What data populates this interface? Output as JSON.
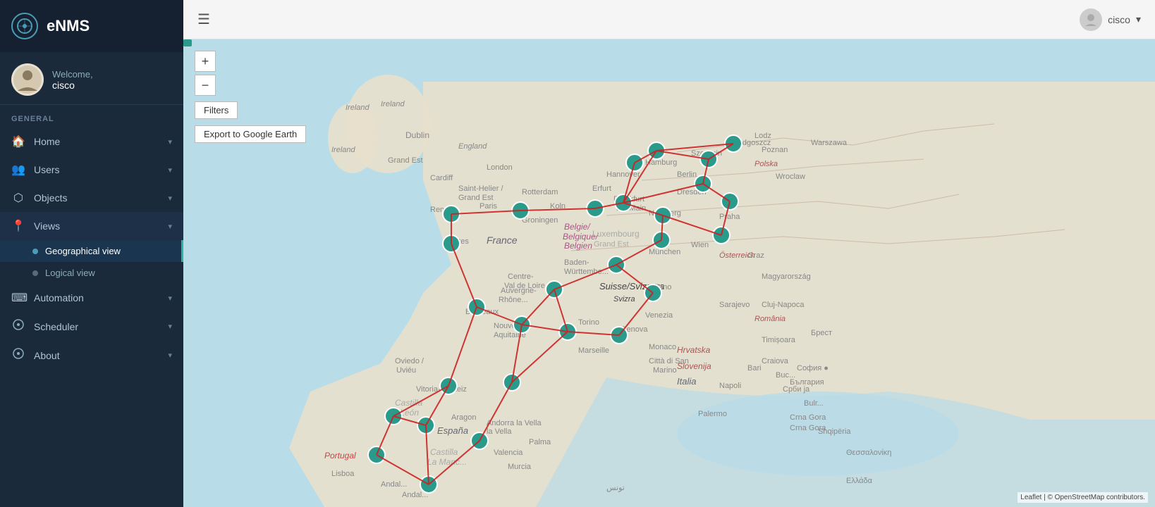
{
  "app": {
    "name": "eNMS",
    "logo_symbol": "⊙"
  },
  "user": {
    "welcome_text": "Welcome,",
    "name": "cisco",
    "avatar_emoji": "👤"
  },
  "topbar": {
    "user_label": "cisco",
    "chevron": "▾"
  },
  "sidebar": {
    "general_label": "GENERAL",
    "items": [
      {
        "id": "home",
        "label": "Home",
        "icon": "🏠",
        "has_children": true,
        "expanded": false
      },
      {
        "id": "users",
        "label": "Users",
        "icon": "👥",
        "has_children": true,
        "expanded": false
      },
      {
        "id": "objects",
        "label": "Objects",
        "icon": "⬡",
        "has_children": true,
        "expanded": false
      },
      {
        "id": "views",
        "label": "Views",
        "icon": "📍",
        "has_children": true,
        "expanded": true
      },
      {
        "id": "automation",
        "label": "Automation",
        "icon": "⌨",
        "has_children": true,
        "expanded": false
      },
      {
        "id": "scheduler",
        "label": "Scheduler",
        "icon": "⊙",
        "has_children": true,
        "expanded": false
      },
      {
        "id": "about",
        "label": "About",
        "icon": "⊙",
        "has_children": true,
        "expanded": false
      }
    ],
    "views_children": [
      {
        "id": "geographical-view",
        "label": "Geographical view",
        "active": true
      },
      {
        "id": "logical-view",
        "label": "Logical view",
        "active": false
      }
    ]
  },
  "map": {
    "zoom_in_label": "+",
    "zoom_out_label": "−",
    "filter_label": "Filters",
    "export_label": "Export to Google Earth",
    "attribution": "Leaflet | © OpenStreetMap contributors."
  }
}
